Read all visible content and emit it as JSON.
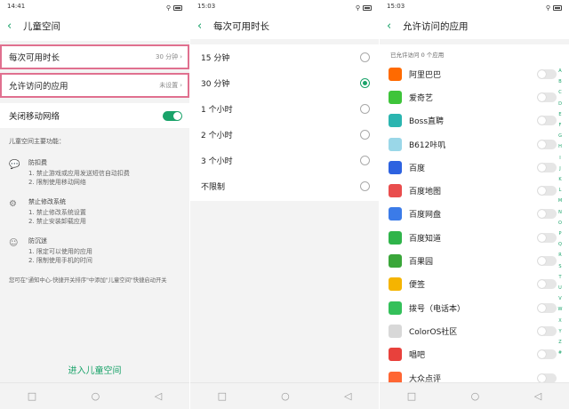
{
  "screen1": {
    "status": {
      "time": "14:41",
      "signal": "5ill 5ill"
    },
    "title": "儿童空间",
    "rows": [
      {
        "label": "每次可用时长",
        "value": "30 分钟"
      },
      {
        "label": "允许访问的应用",
        "value": "未设置"
      }
    ],
    "toggle_row": {
      "label": "关闭移动网络"
    },
    "info_heading": "儿童空间主要功能：",
    "features": [
      {
        "icon": "chat-icon",
        "name": "防扣费",
        "lines": [
          "1. 禁止游戏或应用发送短信自动扣费",
          "2. 限制使用移动网络"
        ]
      },
      {
        "icon": "gear-icon",
        "name": "禁止修改系统",
        "lines": [
          "1. 禁止修改系统设置",
          "2. 禁止安装卸载应用"
        ]
      },
      {
        "icon": "child-icon",
        "name": "防沉迷",
        "lines": [
          "1. 限定可以使用的应用",
          "2. 限制使用手机的时间"
        ]
      }
    ],
    "footnote": "您可在\"通知中心-快捷开关排序\"中添加\"儿童空间\"快捷启动开关",
    "enter_button": "进入儿童空间"
  },
  "screen2": {
    "status": {
      "time": "15:03",
      "signal": "5ill 5ill"
    },
    "title": "每次可用时长",
    "options": [
      {
        "label": "15 分钟",
        "selected": false
      },
      {
        "label": "30 分钟",
        "selected": true
      },
      {
        "label": "1 个小时",
        "selected": false
      },
      {
        "label": "2 个小时",
        "selected": false
      },
      {
        "label": "3 个小时",
        "selected": false
      },
      {
        "label": "不限制",
        "selected": false
      }
    ]
  },
  "screen3": {
    "status": {
      "time": "15:03",
      "signal": "5ill 5ill"
    },
    "title": "允许访问的应用",
    "subtitle": "已允许访问 0 个应用",
    "apps": [
      {
        "name": "阿里巴巴",
        "icon": "alibaba-icon",
        "color": "#ff6a00"
      },
      {
        "name": "爱奇艺",
        "icon": "iqiyi-icon",
        "color": "#3ec43a"
      },
      {
        "name": "Boss直聘",
        "icon": "boss-icon",
        "color": "#2bb5b0"
      },
      {
        "name": "B612咔叽",
        "icon": "b612-icon",
        "color": "#9ad7e8"
      },
      {
        "name": "百度",
        "icon": "baidu-icon",
        "color": "#2d62e0"
      },
      {
        "name": "百度地图",
        "icon": "baidu-map-icon",
        "color": "#e94d4d"
      },
      {
        "name": "百度网盘",
        "icon": "baidu-netdisk-icon",
        "color": "#3b7be8"
      },
      {
        "name": "百度知道",
        "icon": "baidu-zhidao-icon",
        "color": "#2fb44a"
      },
      {
        "name": "百果园",
        "icon": "baiguoyuan-icon",
        "color": "#3aa63a"
      },
      {
        "name": "便签",
        "icon": "notes-icon",
        "color": "#f5b400"
      },
      {
        "name": "拨号（电话本）",
        "icon": "phone-icon",
        "color": "#34c05a"
      },
      {
        "name": "ColorOS社区",
        "icon": "coloros-icon",
        "color": "#d8d8d8"
      },
      {
        "name": "唱吧",
        "icon": "changba-icon",
        "color": "#e8413c"
      },
      {
        "name": "大众点评",
        "icon": "dianping-icon",
        "color": "#ff6633"
      }
    ],
    "alphabet": [
      "A",
      "B",
      "C",
      "D",
      "E",
      "F",
      "G",
      "H",
      "I",
      "J",
      "K",
      "L",
      "M",
      "N",
      "O",
      "P",
      "Q",
      "R",
      "S",
      "T",
      "U",
      "V",
      "W",
      "X",
      "Y",
      "Z",
      "#"
    ]
  },
  "colors": {
    "accent": "#1aa36a",
    "highlight": "#e0708f"
  }
}
